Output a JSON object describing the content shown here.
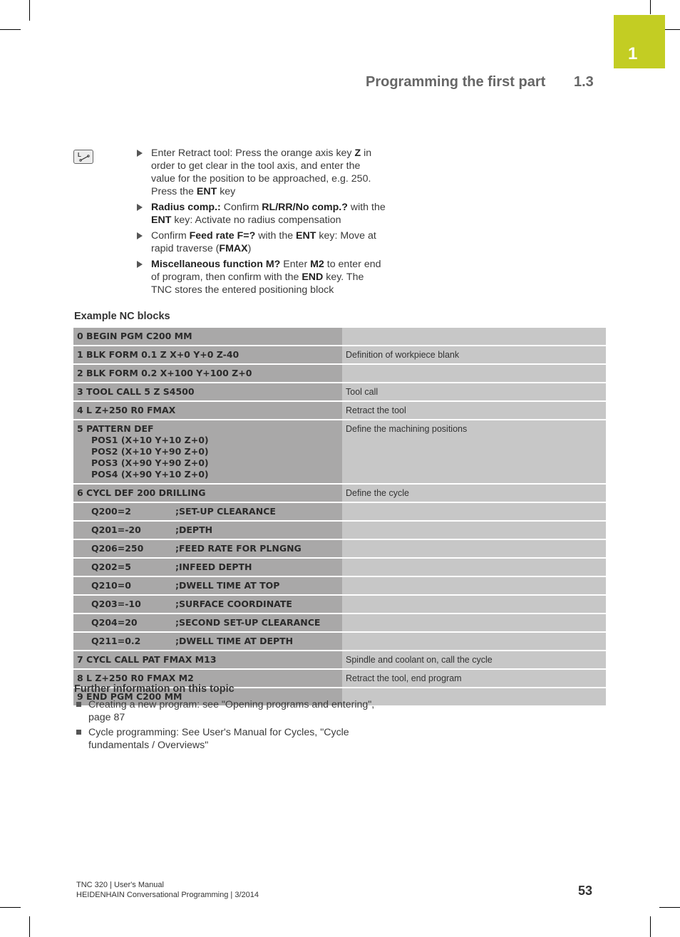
{
  "chapter": {
    "number": "1",
    "accent_color": "#c3cd23"
  },
  "header": {
    "title": "Programming the first part",
    "section": "1.3"
  },
  "key_icon": {
    "name": "l-line-key-icon",
    "label": "L"
  },
  "steps": [
    {
      "parts": [
        {
          "t": "Enter Retract tool: Press the orange axis key ",
          "b": false
        },
        {
          "t": "Z",
          "b": true
        },
        {
          "t": " in order to get clear in the tool axis, and enter the value for the position to be approached, e.g. 250. Press the ",
          "b": false
        },
        {
          "t": "ENT",
          "b": true
        },
        {
          "t": " key",
          "b": false
        }
      ]
    },
    {
      "parts": [
        {
          "t": "Radius comp.:",
          "b": true
        },
        {
          "t": " Confirm ",
          "b": false
        },
        {
          "t": "RL/RR/No comp.?",
          "b": true
        },
        {
          "t": " with the ",
          "b": false
        },
        {
          "t": "ENT",
          "b": true
        },
        {
          "t": " key: Activate no radius compensation",
          "b": false
        }
      ]
    },
    {
      "parts": [
        {
          "t": "Confirm ",
          "b": false
        },
        {
          "t": "Feed rate F=?",
          "b": true
        },
        {
          "t": " with the ",
          "b": false
        },
        {
          "t": "ENT",
          "b": true
        },
        {
          "t": " key: Move at rapid traverse (",
          "b": false
        },
        {
          "t": "FMAX",
          "b": true
        },
        {
          "t": ")",
          "b": false
        }
      ]
    },
    {
      "parts": [
        {
          "t": "Miscellaneous function M?",
          "b": true
        },
        {
          "t": " Enter ",
          "b": false
        },
        {
          "t": "M2",
          "b": true
        },
        {
          "t": " to enter end of program, then confirm with the ",
          "b": false
        },
        {
          "t": "END",
          "b": true
        },
        {
          "t": " key. The TNC stores the entered positioning block",
          "b": false
        }
      ]
    }
  ],
  "example": {
    "heading": "Example NC blocks",
    "rows": [
      {
        "type": "code",
        "code": "0 BEGIN PGM C200 MM",
        "desc": ""
      },
      {
        "type": "code",
        "code": "1 BLK FORM 0.1 Z X+0 Y+0 Z-40",
        "desc": "Definition of workpiece blank"
      },
      {
        "type": "code",
        "code": "2 BLK FORM 0.2 X+100 Y+100 Z+0",
        "desc": ""
      },
      {
        "type": "code",
        "code": "3 TOOL CALL 5 Z S4500",
        "desc": "Tool call"
      },
      {
        "type": "code",
        "code": "4 L Z+250 R0 FMAX",
        "desc": "Retract the tool"
      },
      {
        "type": "multi",
        "code": "5 PATTERN DEF",
        "sub": [
          "POS1 (X+10 Y+10 Z+0)",
          "POS2 (X+10 Y+90 Z+0)",
          "POS3 (X+90 Y+90 Z+0)",
          "POS4 (X+90 Y+10 Z+0)"
        ],
        "desc": "Define the machining positions"
      },
      {
        "type": "code",
        "code": "6 CYCL DEF 200 DRILLING",
        "desc": "Define the cycle"
      },
      {
        "type": "param",
        "q": "Q200=2",
        "comment": ";SET-UP CLEARANCE",
        "desc": ""
      },
      {
        "type": "param",
        "q": "Q201=-20",
        "comment": ";DEPTH",
        "desc": ""
      },
      {
        "type": "param",
        "q": "Q206=250",
        "comment": ";FEED RATE FOR PLNGNG",
        "desc": ""
      },
      {
        "type": "param",
        "q": "Q202=5",
        "comment": ";INFEED DEPTH",
        "desc": ""
      },
      {
        "type": "param",
        "q": "Q210=0",
        "comment": ";DWELL TIME AT TOP",
        "desc": ""
      },
      {
        "type": "param",
        "q": "Q203=-10",
        "comment": ";SURFACE COORDINATE",
        "desc": ""
      },
      {
        "type": "param",
        "q": "Q204=20",
        "comment": ";SECOND SET-UP CLEARANCE",
        "desc": ""
      },
      {
        "type": "param",
        "q": "Q211=0.2",
        "comment": ";DWELL TIME AT DEPTH",
        "desc": ""
      },
      {
        "type": "code",
        "code": "7 CYCL CALL PAT FMAX M13",
        "desc": "Spindle and coolant on, call the cycle"
      },
      {
        "type": "code",
        "code": "8 L Z+250 R0 FMAX M2",
        "desc": "Retract the tool, end program"
      },
      {
        "type": "code",
        "code": "9 END PGM C200 MM",
        "desc": ""
      }
    ]
  },
  "further": {
    "heading": "Further information on this topic",
    "items": [
      "Creating a new program: see \"Opening programs and entering\", page 87",
      "Cycle programming: See User's Manual for Cycles, \"Cycle fundamentals / Overviews\""
    ]
  },
  "footer": {
    "line1": "TNC 320 | User's Manual",
    "line2": "HEIDENHAIN Conversational Programming | 3/2014",
    "page": "53"
  }
}
